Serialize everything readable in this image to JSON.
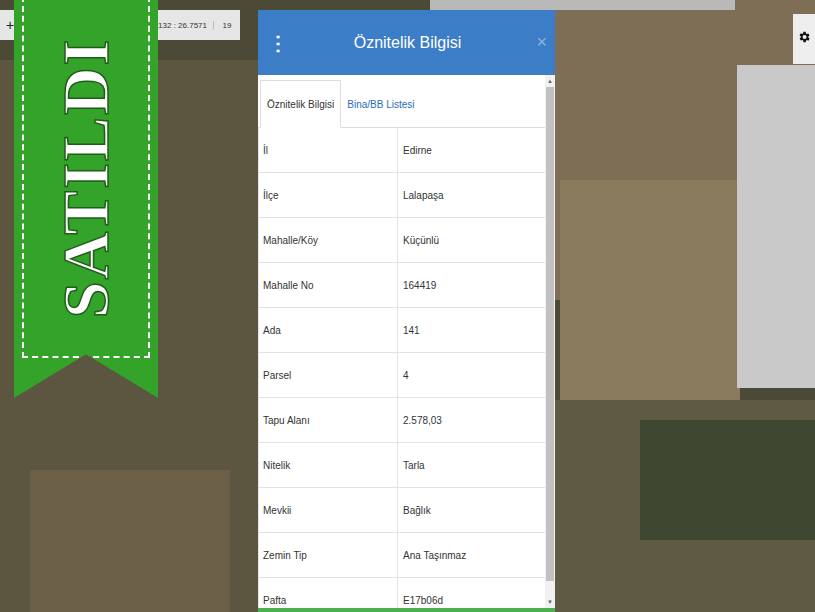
{
  "map": {
    "zoom_bar": {
      "button": "+",
      "coordinates": "41.9132 : 26.7571",
      "zoom": "19"
    }
  },
  "badge": {
    "text": "SATILDI"
  },
  "dialog": {
    "menu_icon": "⋮",
    "title": "Öznitelik Bilgisi",
    "close": "×",
    "tabs": [
      {
        "label": "Öznitelik Bilgisi",
        "selected": true
      },
      {
        "label": "Bina/BB Listesi",
        "selected": false
      }
    ],
    "rows": [
      {
        "label": "İl",
        "value": "Edirne"
      },
      {
        "label": "İlçe",
        "value": "Lalapaşa"
      },
      {
        "label": "Mahalle/Köy",
        "value": "Küçünlü"
      },
      {
        "label": "Mahalle No",
        "value": "164419"
      },
      {
        "label": "Ada",
        "value": "141"
      },
      {
        "label": "Parsel",
        "value": "4"
      },
      {
        "label": "Tapu Alanı",
        "value": "2.578,03"
      },
      {
        "label": "Nitelik",
        "value": "Tarla"
      },
      {
        "label": "Mevkii",
        "value": "Bağlık"
      },
      {
        "label": "Zemin Tip",
        "value": "Ana Taşınmaz"
      },
      {
        "label": "Pafta",
        "value": "E17b06d"
      }
    ],
    "scroll": {
      "up": "▲",
      "down": "▼",
      "level": 0.97
    }
  }
}
